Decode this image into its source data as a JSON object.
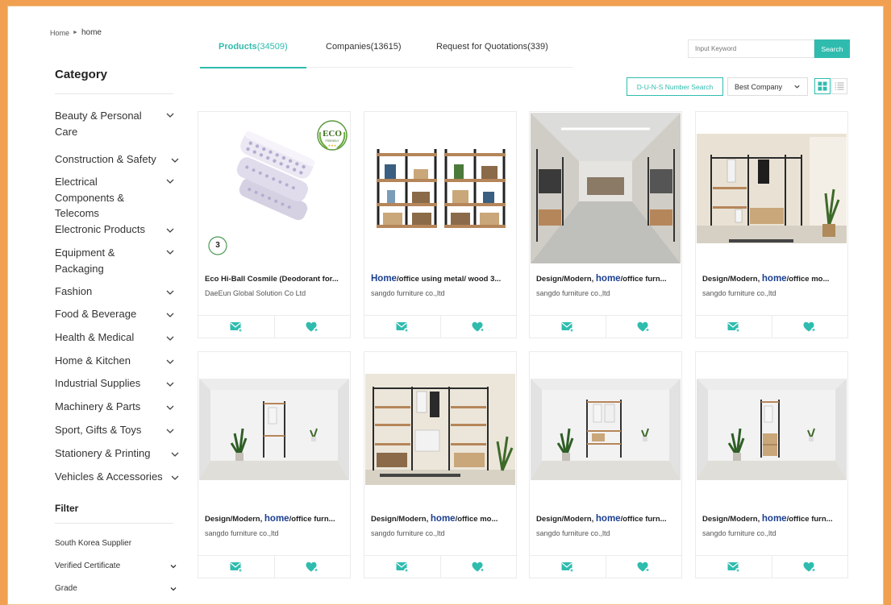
{
  "breadcrumb": {
    "home": "Home",
    "current": "home"
  },
  "sidebar": {
    "category_title": "Category",
    "categories": [
      "Beauty & Personal Care",
      "Construction & Safety",
      "Electrical Components & Telecoms",
      "Electronic Products",
      "Equipment & Packaging",
      "Fashion",
      "Food & Beverage",
      "Health & Medical",
      "Home & Kitchen",
      "Industrial Supplies",
      "Machinery & Parts",
      "Sport, Gifts & Toys",
      "Stationery & Printing",
      "Vehicles & Accessories"
    ],
    "filter_title": "Filter",
    "filters": [
      "South Korea Supplier",
      "Verified Certificate",
      "Grade"
    ]
  },
  "tabs": [
    {
      "label": "Products",
      "count": "(34509)"
    },
    {
      "label": "Companies(13615)"
    },
    {
      "label": "Request for Quotations(339)"
    }
  ],
  "search": {
    "placeholder": "Input Keyword",
    "button": "Search"
  },
  "toolbar": {
    "duns": "D-U-N-S Number Search",
    "sort": "Best Company"
  },
  "cards": [
    {
      "pre": "Eco Hi-Ball Cosmile (Deodorant for...",
      "kw": "",
      "post": "",
      "company": "DaeEun Global Solution Co Ltd",
      "eco_badge": "ECO",
      "eco_sub": "FRIENDLY",
      "pack_badge": "3"
    },
    {
      "pre": "",
      "kw": "Home",
      "post": "/office using metal/ wood 3...",
      "company": "sangdo furniture co.,ltd"
    },
    {
      "pre": "Design/Modern, ",
      "kw": "home",
      "post": "/office furn...",
      "company": "sangdo furniture co.,ltd"
    },
    {
      "pre": "Design/Modern, ",
      "kw": "home",
      "post": "/office mo...",
      "company": "sangdo furniture co.,ltd"
    },
    {
      "pre": "Design/Modern, ",
      "kw": "home",
      "post": "/office furn...",
      "company": "sangdo furniture co.,ltd"
    },
    {
      "pre": "Design/Modern, ",
      "kw": "home",
      "post": "/office mo...",
      "company": "sangdo furniture co.,ltd"
    },
    {
      "pre": "Design/Modern, ",
      "kw": "home",
      "post": "/office furn...",
      "company": "sangdo furniture co.,ltd"
    },
    {
      "pre": "Design/Modern, ",
      "kw": "home",
      "post": "/office furn...",
      "company": "sangdo furniture co.,ltd"
    }
  ],
  "colors": {
    "accent": "#2fbcae",
    "keyword": "#1b3f8f",
    "page_border": "#f0a050"
  }
}
